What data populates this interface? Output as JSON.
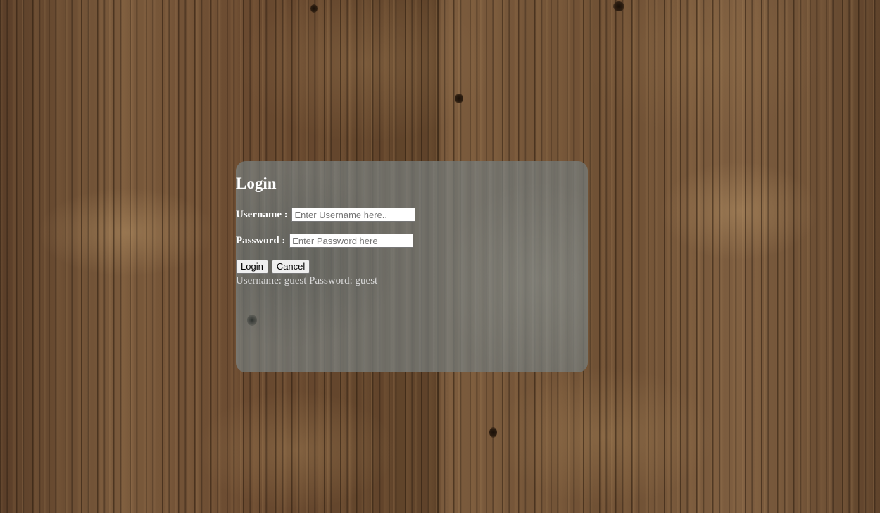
{
  "login": {
    "title": "Login",
    "username_label": "Username : ",
    "username_placeholder": "Enter Username here..",
    "username_value": "",
    "password_label": "Password : ",
    "password_placeholder": "Enter Password here",
    "password_value": "",
    "login_button": "Login",
    "cancel_button": "Cancel",
    "hint_text": "Username: guest Password: guest"
  }
}
